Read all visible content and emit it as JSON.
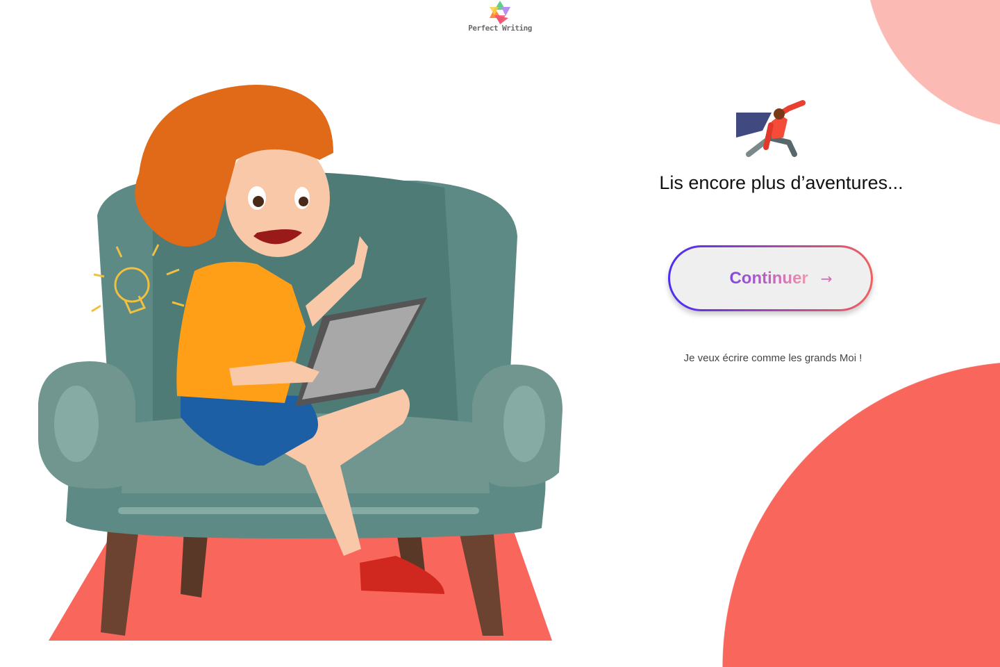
{
  "logo": {
    "text": "Perfect Writing"
  },
  "main": {
    "headline": "Lis encore plus d’aventures...",
    "continue_label": "Continuer",
    "continue_icon": "arrow-right-icon",
    "arrow_glyph": "→",
    "subtitle": "Je veux écrire comme les grands Moi !"
  },
  "colors": {
    "accent_red": "#f9665c",
    "accent_pink": "#fbbab4",
    "gradient_start": "#4a2ef0",
    "gradient_end": "#f0605e"
  }
}
